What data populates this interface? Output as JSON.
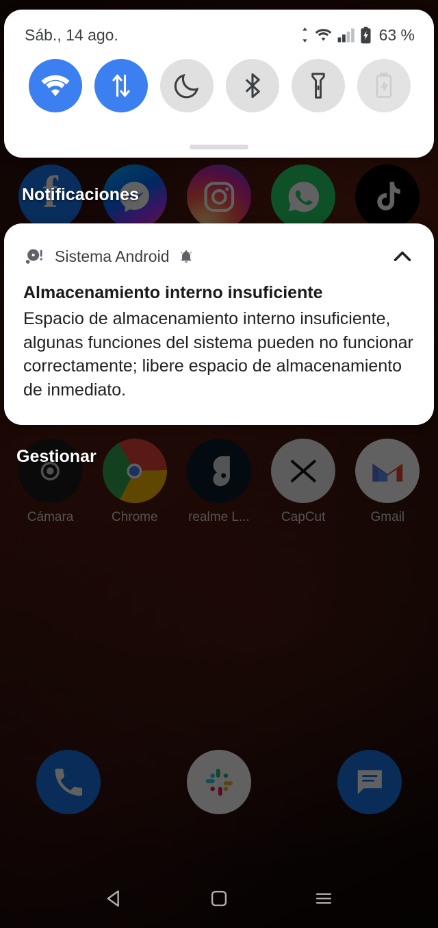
{
  "status_bar": {
    "date": "Sáb., 14 ago.",
    "battery_percent": "63 %",
    "icons": [
      "data-transfer-icon",
      "wifi-icon",
      "signal-bars-icon",
      "battery-charging-icon"
    ]
  },
  "quick_settings": {
    "tiles": [
      {
        "name": "wifi",
        "label": "Wi-Fi",
        "state": "on"
      },
      {
        "name": "mobile-data",
        "label": "Datos móviles",
        "state": "on"
      },
      {
        "name": "do-not-disturb",
        "label": "No molestar",
        "state": "off"
      },
      {
        "name": "bluetooth",
        "label": "Bluetooth",
        "state": "off"
      },
      {
        "name": "flashlight",
        "label": "Linterna",
        "state": "off"
      },
      {
        "name": "battery-saver",
        "label": "Ahorro de batería",
        "state": "disabled"
      }
    ],
    "drag_handle": "drag-handle"
  },
  "sections": {
    "notifications_label": "Notificaciones",
    "manage_label": "Gestionar"
  },
  "notification": {
    "app_name": "Sistema Android",
    "title": "Almacenamiento interno insuficiente",
    "body": "Espacio de almacenamiento interno insuficiente, algunas funciones del sistema pueden no funcionar correctamente; libere espacio de almacenamiento de inmediato.",
    "silent_icon": "bell-silent-icon",
    "expand_icon": "chevron-up-icon",
    "app_icon": "storage-alert-icon"
  },
  "home_screen": {
    "row_top": [
      {
        "label": "",
        "icon": "facebook-icon"
      },
      {
        "label": "",
        "icon": "messenger-icon"
      },
      {
        "label": "",
        "icon": "instagram-icon"
      },
      {
        "label": "",
        "icon": "whatsapp-icon"
      },
      {
        "label": "",
        "icon": "tiktok-icon"
      }
    ],
    "row_apps": [
      {
        "label": "Cámara",
        "icon": "camera-icon"
      },
      {
        "label": "Chrome",
        "icon": "chrome-icon"
      },
      {
        "label": "realme L...",
        "icon": "realme-link-icon"
      },
      {
        "label": "CapCut",
        "icon": "capcut-icon"
      },
      {
        "label": "Gmail",
        "icon": "gmail-icon"
      }
    ],
    "dock": [
      {
        "label": "",
        "icon": "phone-icon"
      },
      {
        "label": "",
        "icon": "slack-icon"
      },
      {
        "label": "",
        "icon": "messages-icon"
      }
    ]
  },
  "nav_bar": {
    "back": "back-icon",
    "home": "home-icon",
    "recents": "recents-icon"
  },
  "colors": {
    "tile_active": "#3b7ff0",
    "tile_inactive": "#e0e0e0",
    "card_background": "#ffffff",
    "text_primary": "#202124"
  }
}
